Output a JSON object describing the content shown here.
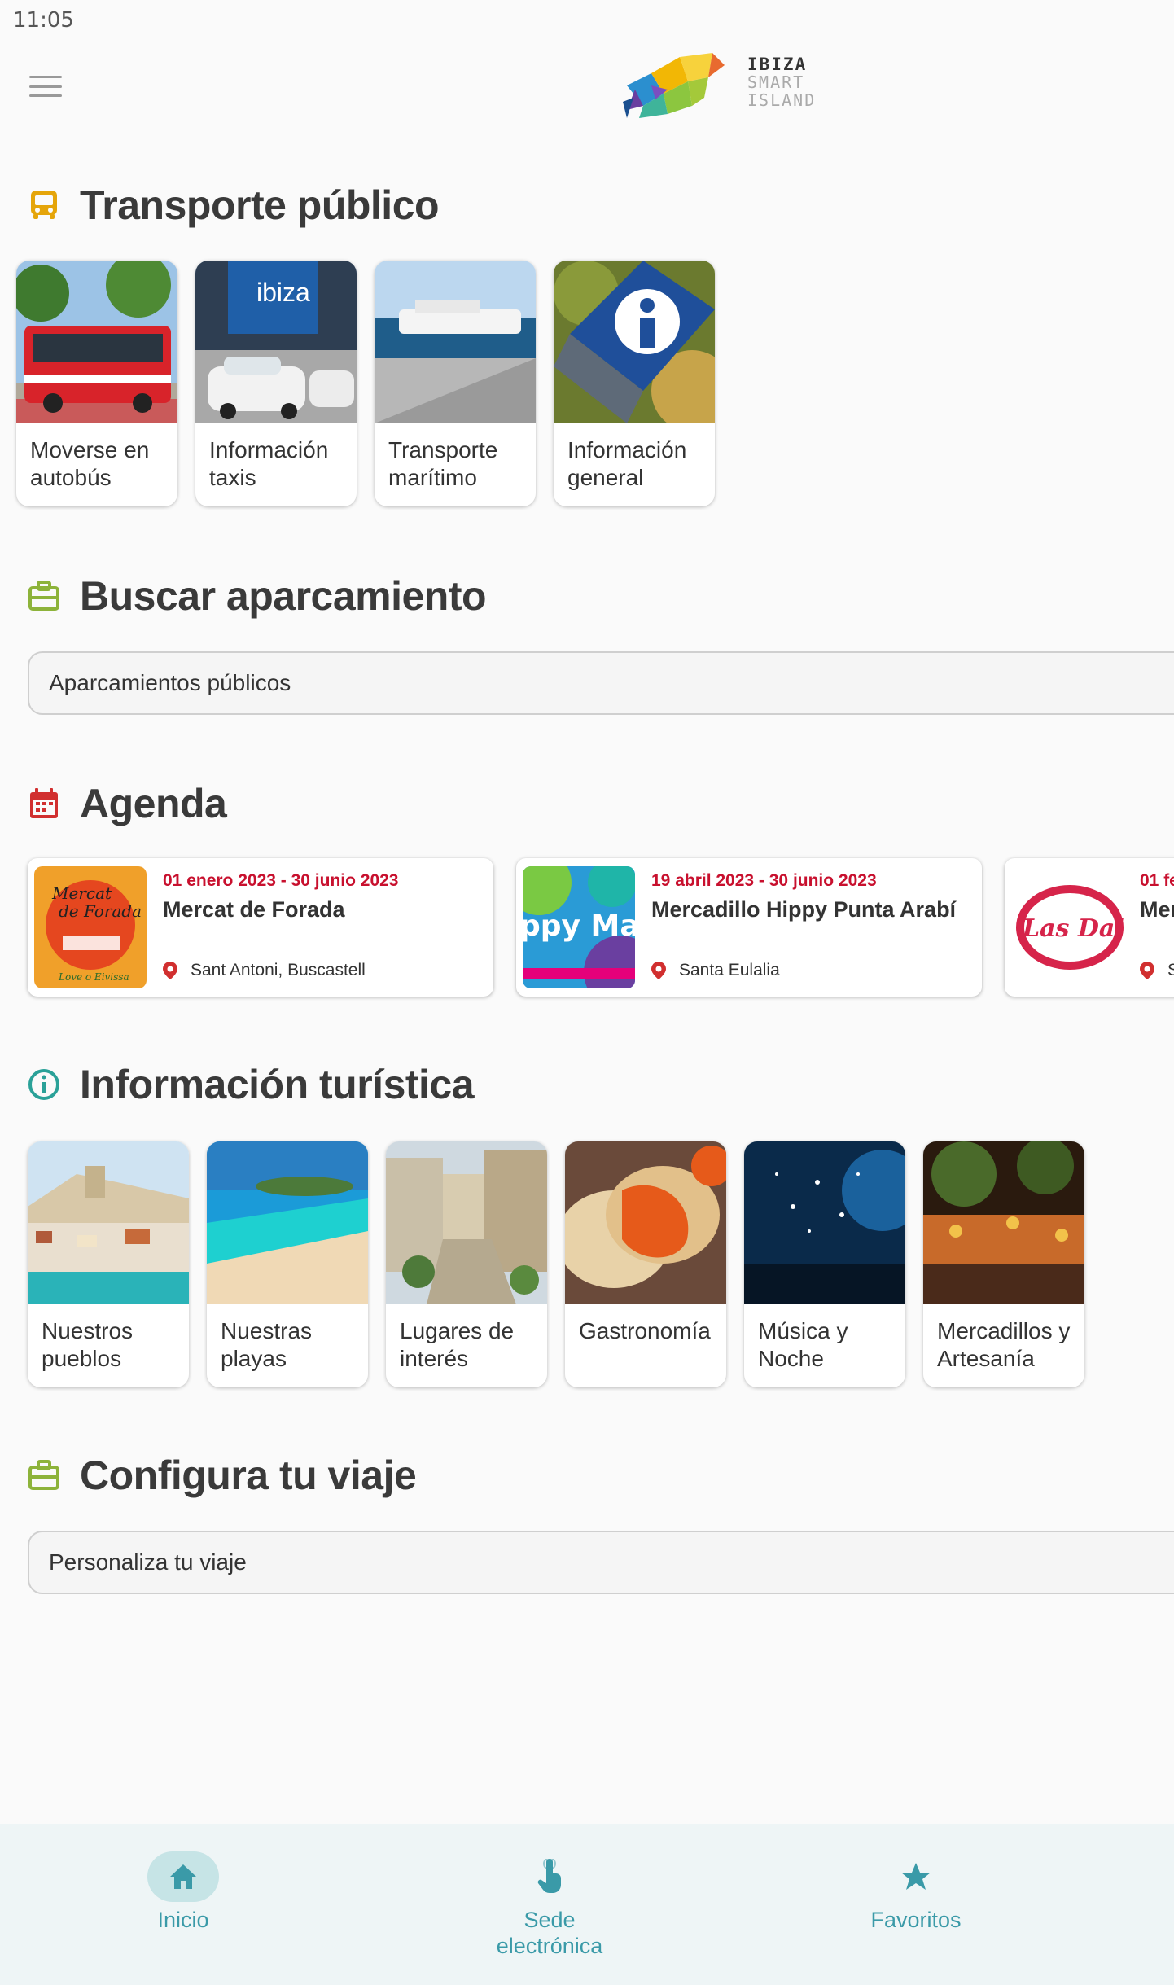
{
  "status": {
    "time": "11:05"
  },
  "logo": {
    "line1": "IBIZA",
    "line2": "SMART",
    "line3": "ISLAND"
  },
  "sections": {
    "transport": {
      "title": "Transporte público",
      "icon": "bus-icon",
      "color": "#e5a50a"
    },
    "parking": {
      "title": "Buscar aparcamiento",
      "icon": "briefcase-icon",
      "color": "#8db33a"
    },
    "agenda": {
      "title": "Agenda",
      "icon": "calendar-icon",
      "color": "#d12f2f"
    },
    "tourism": {
      "title": "Información turística",
      "icon": "info-icon",
      "color": "#2aa198"
    },
    "trip": {
      "title": "Configura tu viaje",
      "icon": "briefcase-icon",
      "color": "#8db33a"
    }
  },
  "transport_tiles": [
    {
      "label": "Moverse en autobús"
    },
    {
      "label": "Información taxis"
    },
    {
      "label": "Transporte marítimo"
    },
    {
      "label": "Información general"
    }
  ],
  "parking": {
    "button": "Aparcamientos públicos"
  },
  "events": [
    {
      "date": "01 enero 2023 - 30 junio 2023",
      "name": "Mercat de Forada",
      "location": "Sant Antoni, Buscastell",
      "thumb_text": "Mercat de Forada"
    },
    {
      "date": "19 abril 2023 - 30 junio 2023",
      "name": "Mercadillo Hippy Punta Arabí",
      "location": "Santa Eulalia",
      "thumb_text": "ppy Mark"
    },
    {
      "date": "01 fe",
      "name": "Mer",
      "location": "S",
      "thumb_text": "Las Dalias"
    }
  ],
  "tourism_tiles": [
    {
      "label": "Nuestros pueblos"
    },
    {
      "label": "Nuestras playas"
    },
    {
      "label": "Lugares de interés"
    },
    {
      "label": "Gastronomía"
    },
    {
      "label": "Música y Noche"
    },
    {
      "label": "Mercadillos y Artesanía"
    }
  ],
  "trip": {
    "button": "Personaliza tu viaje"
  },
  "bottom_nav": [
    {
      "label": "Inicio",
      "icon": "home-icon",
      "active": true
    },
    {
      "label": "Sede electrónica",
      "icon": "touch-hand-icon",
      "active": false
    },
    {
      "label": "Favoritos",
      "icon": "star-icon",
      "active": false
    }
  ]
}
